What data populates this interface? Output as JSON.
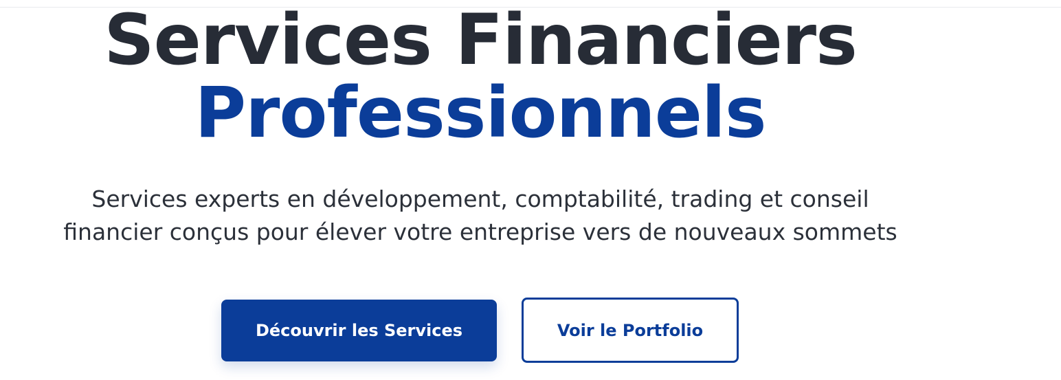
{
  "hero": {
    "title_line1": "Services Financiers",
    "title_line2": "Professionnels",
    "subtitle_line1": "Services experts en développement, comptabilité, trading et conseil",
    "subtitle_line2": "financier conçus pour élever votre entreprise vers de nouveaux sommets"
  },
  "actions": {
    "primary_label": "Découvrir les Services",
    "secondary_label": "Voir le Portfolio"
  },
  "colors": {
    "heading_dark": "#272c36",
    "accent_blue": "#0b3d99",
    "body_text": "#2b3039",
    "background": "#ffffff"
  }
}
